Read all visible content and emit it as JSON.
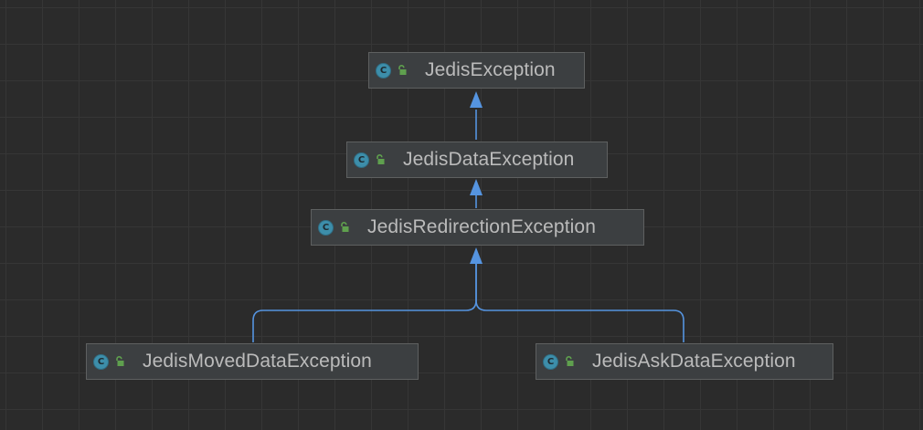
{
  "diagram": {
    "nodes": [
      {
        "id": "jedis-exception",
        "name": "JedisException",
        "kind": "class",
        "visibility": "public",
        "icon": "class-icon"
      },
      {
        "id": "jedis-data-exception",
        "name": "JedisDataException",
        "kind": "class",
        "visibility": "public",
        "icon": "class-icon"
      },
      {
        "id": "jedis-redirection-exception",
        "name": "JedisRedirectionException",
        "kind": "class",
        "visibility": "public",
        "icon": "class-icon"
      },
      {
        "id": "jedis-moved-data-exception",
        "name": "JedisMovedDataException",
        "kind": "class",
        "visibility": "public",
        "icon": "class-icon"
      },
      {
        "id": "jedis-ask-data-exception",
        "name": "JedisAskDataException",
        "kind": "class",
        "visibility": "public",
        "icon": "class-icon"
      }
    ],
    "edges": [
      {
        "from": "jedis-data-exception",
        "to": "jedis-exception",
        "type": "extends"
      },
      {
        "from": "jedis-redirection-exception",
        "to": "jedis-data-exception",
        "type": "extends"
      },
      {
        "from": "jedis-moved-data-exception",
        "to": "jedis-redirection-exception",
        "type": "extends"
      },
      {
        "from": "jedis-ask-data-exception",
        "to": "jedis-redirection-exception",
        "type": "extends"
      }
    ],
    "icon_letter": "C",
    "colors": {
      "background": "#2b2b2b",
      "grid": "#363636",
      "node_fill": "#3c3f41",
      "node_border": "#5e6060",
      "text": "#bbbbbb",
      "edge": "#5594e0",
      "class_icon": "#3d8eaa",
      "lock_icon": "#5fa04e"
    }
  }
}
